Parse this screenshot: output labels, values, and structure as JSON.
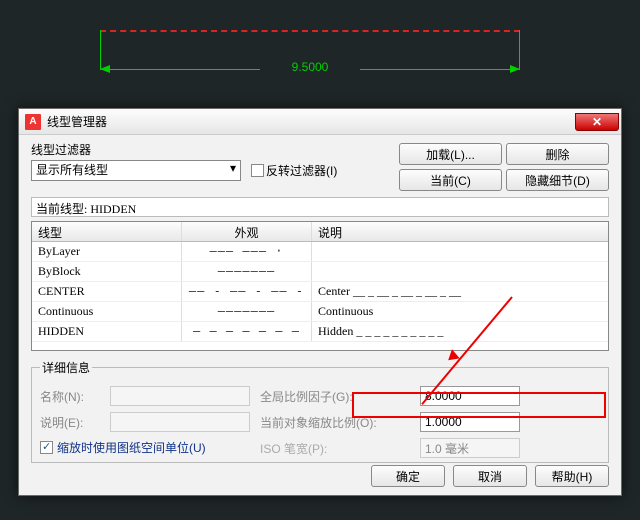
{
  "canvas": {
    "measurement": "9.5000"
  },
  "dialog": {
    "title": "线型管理器",
    "close": "✕",
    "filter": {
      "label": "线型过滤器",
      "selected": "显示所有线型",
      "invert": "反转过滤器(I)"
    },
    "buttons_tr": {
      "load": "加载(L)...",
      "delete": "删除",
      "current": "当前(C)",
      "hide": "隐藏细节(D)"
    },
    "current_line_label": "当前线型:",
    "current_line_value": "HIDDEN",
    "columns": {
      "name": "线型",
      "appearance": "外观",
      "desc": "说明"
    },
    "rows": [
      {
        "name": "ByLayer",
        "appearance": "——— ——— ·",
        "desc": ""
      },
      {
        "name": "ByBlock",
        "appearance": "———————",
        "desc": ""
      },
      {
        "name": "CENTER",
        "appearance": "—— - —— - —— -",
        "desc": "Center __ _ __ _ __ _ __ _ __"
      },
      {
        "name": "Continuous",
        "appearance": "———————",
        "desc": "Continuous"
      },
      {
        "name": "HIDDEN",
        "appearance": "– – – – – – –",
        "desc": "Hidden _ _ _ _ _ _ _ _ _ _"
      }
    ],
    "details": {
      "legend": "详细信息",
      "name_label": "名称(N):",
      "name_value": "",
      "desc_label": "说明(E):",
      "desc_value": "",
      "global_label": "全局比例因子(G):",
      "global_value": "8.0000",
      "obj_label": "当前对象缩放比例(O):",
      "obj_value": "1.0000",
      "iso_label": "ISO 笔宽(P):",
      "iso_value": "1.0 毫米",
      "use_paper": "缩放时使用图纸空间单位(U)"
    },
    "bottom": {
      "ok": "确定",
      "cancel": "取消",
      "help": "帮助(H)"
    }
  }
}
